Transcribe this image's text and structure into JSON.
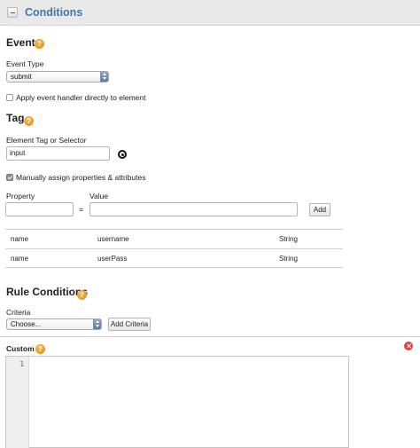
{
  "header": {
    "title": "Conditions"
  },
  "event": {
    "title": "Event",
    "type_label": "Event Type",
    "type_value": "submit",
    "apply_directly_label": "Apply event handler directly to element",
    "apply_directly_checked": false
  },
  "tag": {
    "title": "Tag",
    "selector_label": "Element Tag or Selector",
    "selector_value": "input",
    "manual_assign_label": "Manually assign properties & attributes",
    "manual_assign_checked": true,
    "property_label": "Property",
    "value_label": "Value",
    "equals": "=",
    "add_label": "Add",
    "rows": [
      {
        "name": "name",
        "value": "username",
        "type": "String"
      },
      {
        "name": "name",
        "value": "userPass",
        "type": "String"
      }
    ]
  },
  "rule_conditions": {
    "title": "Rule Conditions",
    "criteria_label": "Criteria",
    "criteria_value": "Choose...",
    "add_criteria_label": "Add Criteria",
    "custom_label": "Custom",
    "editor_line_numbers": [
      "1"
    ]
  },
  "help_glyph": "?",
  "colors": {
    "accent": "#3d79b0",
    "help": "#e48a10",
    "remove": "#d9453d"
  }
}
